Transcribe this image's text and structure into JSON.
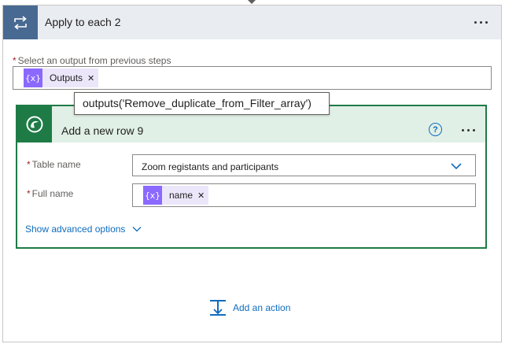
{
  "loop": {
    "title": "Apply to each 2",
    "select_label": "Select an output from previous steps",
    "token": {
      "label": "Outputs",
      "icon_glyph": "{x}"
    },
    "tooltip": "outputs('Remove_duplicate_from_Filter_array')"
  },
  "action_card": {
    "title": "Add a new row 9",
    "help_glyph": "?",
    "fields": {
      "table_name": {
        "label": "Table name",
        "value": "Zoom registants and participants"
      },
      "full_name": {
        "label": "Full name",
        "token": {
          "label": "name",
          "icon_glyph": "{x}"
        }
      }
    },
    "advanced_link": "Show advanced options"
  },
  "footer": {
    "add_action_label": "Add an action"
  },
  "colors": {
    "loop_accent": "#486991",
    "dataverse_green": "#1e7b46",
    "token_purple": "#8b69ff",
    "link_blue": "#0f6cbd"
  },
  "icons": {
    "loop": "loop-icon",
    "dataverse": "dataverse-icon",
    "expression": "expression-icon",
    "help": "help-icon",
    "more": "more-icon",
    "chevron": "chevron-down-icon",
    "add_action": "add-action-icon"
  }
}
